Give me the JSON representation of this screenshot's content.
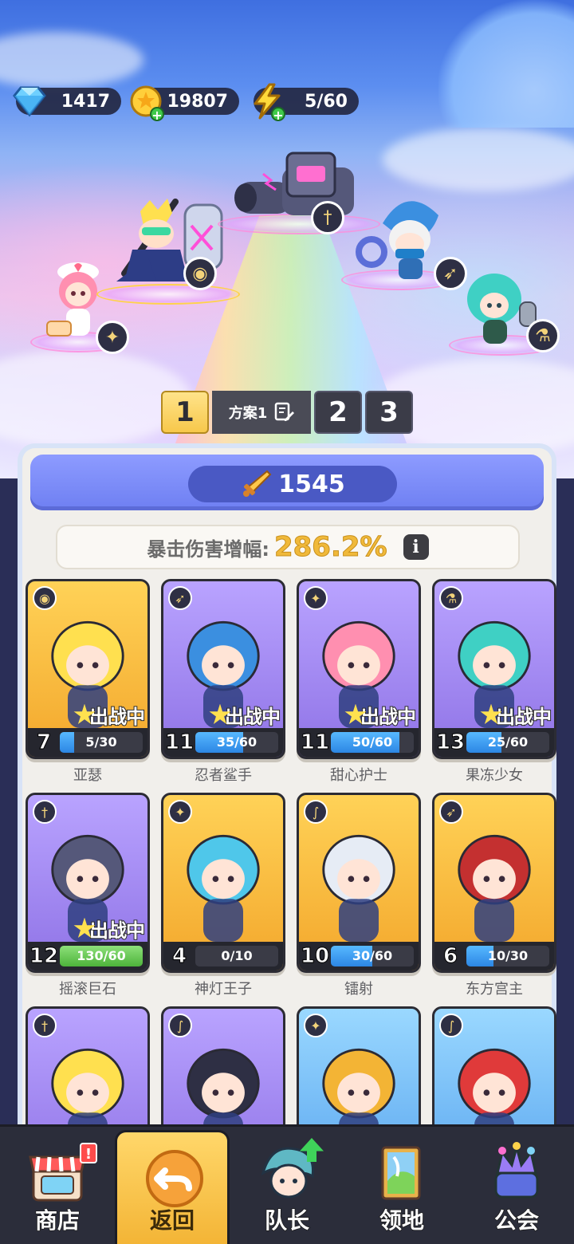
{
  "resources": {
    "gems": "1417",
    "coins": "19807",
    "energy": "5/60"
  },
  "plans": {
    "tabs": [
      "1",
      "2",
      "3"
    ],
    "active_name": "方案1"
  },
  "panel": {
    "power": "1545",
    "crit_label": "暴击伤害增幅:",
    "crit_value": "286.2%",
    "info_glyph": "i",
    "in_battle_label": "出战中"
  },
  "heroes": [
    {
      "name": "亚瑟",
      "level": "7",
      "xp": "5/30",
      "xp_fraction": 0.17,
      "in_battle": true,
      "class_icon": "tank-icon",
      "card_color": "gold"
    },
    {
      "name": "忍者鲨手",
      "level": "11",
      "xp": "35/60",
      "xp_fraction": 0.58,
      "in_battle": true,
      "class_icon": "bow-icon",
      "card_color": "purple"
    },
    {
      "name": "甜心护士",
      "level": "11",
      "xp": "50/60",
      "xp_fraction": 0.83,
      "in_battle": true,
      "class_icon": "wings-icon",
      "card_color": "purple"
    },
    {
      "name": "果冻少女",
      "level": "13",
      "xp": "25/60",
      "xp_fraction": 0.42,
      "in_battle": true,
      "class_icon": "potion-icon",
      "card_color": "purple"
    },
    {
      "name": "摇滚巨石",
      "level": "12",
      "xp": "130/60",
      "xp_fraction": 1.0,
      "in_battle": true,
      "class_icon": "sword-icon",
      "card_color": "purple"
    },
    {
      "name": "神灯王子",
      "level": "4",
      "xp": "0/10",
      "xp_fraction": 0.0,
      "in_battle": false,
      "class_icon": "wings-icon",
      "card_color": "gold"
    },
    {
      "name": "镭射",
      "level": "10",
      "xp": "30/60",
      "xp_fraction": 0.5,
      "in_battle": false,
      "class_icon": "staff-icon",
      "card_color": "gold"
    },
    {
      "name": "东方宫主",
      "level": "6",
      "xp": "10/30",
      "xp_fraction": 0.33,
      "in_battle": false,
      "class_icon": "bow-icon",
      "card_color": "gold"
    },
    {
      "name": "",
      "level": "",
      "xp": "",
      "xp_fraction": 0,
      "in_battle": false,
      "class_icon": "sword-icon",
      "card_color": "purple"
    },
    {
      "name": "",
      "level": "",
      "xp": "",
      "xp_fraction": 0,
      "in_battle": false,
      "class_icon": "staff-icon",
      "card_color": "purple"
    },
    {
      "name": "",
      "level": "",
      "xp": "",
      "xp_fraction": 0,
      "in_battle": false,
      "class_icon": "wings-icon",
      "card_color": "blue"
    },
    {
      "name": "",
      "level": "",
      "xp": "",
      "xp_fraction": 0,
      "in_battle": false,
      "class_icon": "staff-icon",
      "card_color": "blue"
    }
  ],
  "nav": {
    "shop": "商店",
    "back": "返回",
    "captain": "队长",
    "territory": "领地",
    "guild": "公会",
    "shop_badge": "!"
  },
  "colors": {
    "accent_gold": "#f7c84b",
    "xp_blue": "#2c86e4",
    "xp_full_green": "#4db33a",
    "power_banner": "#6e7ff2"
  }
}
